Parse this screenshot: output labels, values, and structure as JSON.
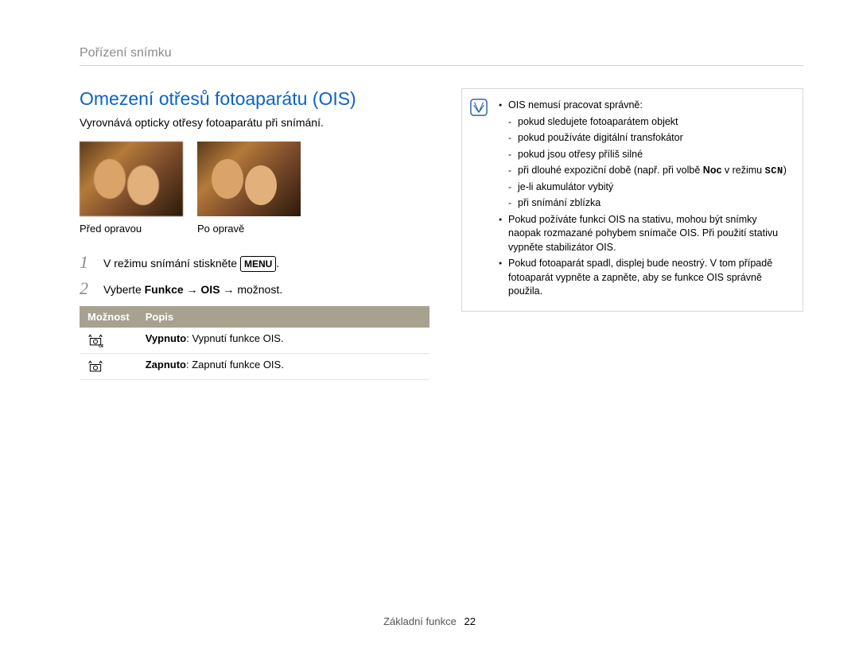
{
  "breadcrumb": "Pořízení snímku",
  "heading": "Omezení otřesů fotoaparátu (OIS)",
  "subheading": "Vyrovnává opticky otřesy fotoaparátu při snímání.",
  "images": {
    "before_caption": "Před opravou",
    "after_caption": "Po opravě"
  },
  "steps": [
    {
      "num": "1",
      "prefix": "V režimu snímání stiskněte ",
      "menu_label": "MENU",
      "suffix": "."
    },
    {
      "num": "2",
      "text_parts": [
        "Vyberte ",
        "Funkce",
        " → ",
        "OIS",
        " → možnost."
      ]
    }
  ],
  "table": {
    "headers": [
      "Možnost",
      "Popis"
    ],
    "rows": [
      {
        "icon": "ois-off-icon",
        "term": "Vypnuto",
        "desc": ": Vypnutí funkce OIS."
      },
      {
        "icon": "ois-on-icon",
        "term": "Zapnuto",
        "desc": ": Zapnutí funkce OIS."
      }
    ]
  },
  "note": {
    "items": [
      {
        "text": "OIS nemusí pracovat správně:",
        "sub": [
          "pokud sledujete fotoaparátem objekt",
          "pokud používáte digitální transfokátor",
          "pokud jsou otřesy příliš silné",
          {
            "prefix": "při dlouhé expoziční době (např. při volbě ",
            "bold": "Noc",
            "middle": " v režimu ",
            "scn": "SCN",
            "suffix": ")"
          },
          "je-li akumulátor vybitý",
          "při snímání zblízka"
        ]
      },
      {
        "text": "Pokud požíváte funkci OIS na stativu, mohou být snímky naopak rozmazané pohybem snímače OIS. Při použití stativu vypněte stabilizátor OIS."
      },
      {
        "text": "Pokud fotoaparát spadl, displej bude neostrý. V tom případě fotoaparát vypněte a zapněte, aby se funkce OIS správně použila."
      }
    ]
  },
  "footer": {
    "section": "Základní funkce",
    "page": "22"
  }
}
